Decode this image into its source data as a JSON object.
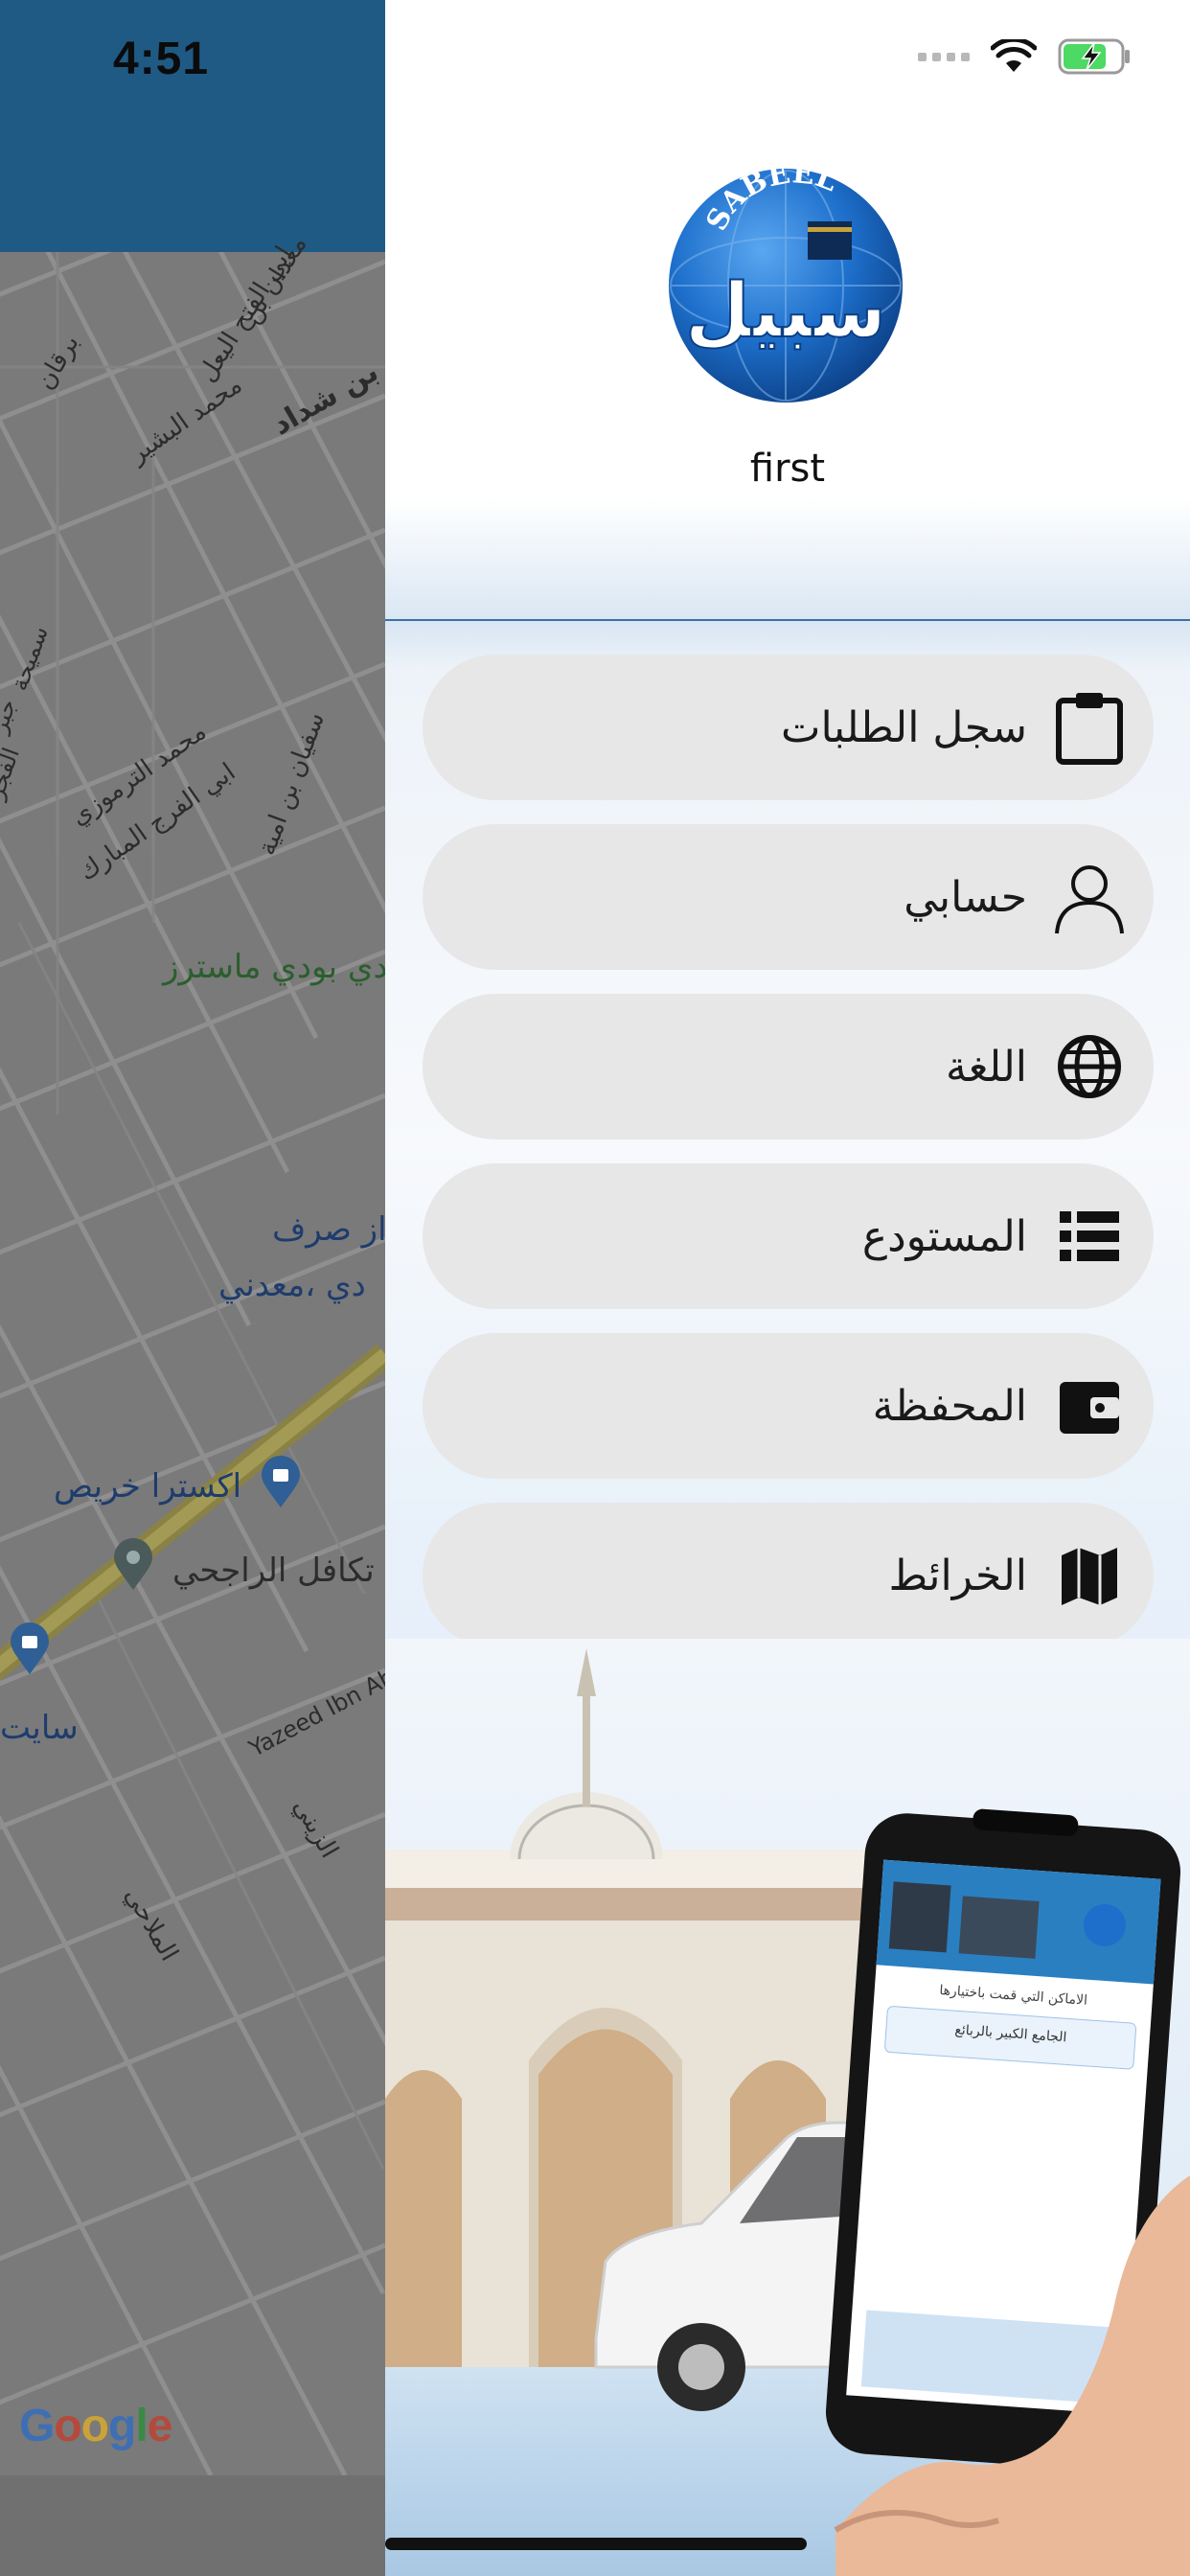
{
  "status_bar": {
    "time": "4:51"
  },
  "drawer": {
    "brand_latin": "SABEEL",
    "brand_arabic": "سبيل",
    "username": "first",
    "menu": [
      {
        "label": "سجل الطلبات",
        "icon": "clipboard-icon"
      },
      {
        "label": "حسابي",
        "icon": "user-icon"
      },
      {
        "label": "اللغة",
        "icon": "globe-icon"
      },
      {
        "label": "المستودع",
        "icon": "warehouse-list-icon"
      },
      {
        "label": "المحفظة",
        "icon": "wallet-icon"
      },
      {
        "label": "الخرائط",
        "icon": "map-icon"
      }
    ]
  },
  "map": {
    "labels": {
      "body_masters": "دي بودي ماسترز",
      "exchange": "از صرف",
      "madani": "دي ،معدني",
      "extra": "اكسترا خريص",
      "takaful": "تكافل الراجحي",
      "site": "سايت",
      "street_1": "معدان بن",
      "street_2": "ابي الفتح اليعل",
      "street_3": "رة بن شداد",
      "street_4": "محمد البشير",
      "street_5": "برقان",
      "street_6": "محمد الترموزي",
      "street_7": "ابي الفرج المبارك",
      "street_8": "سفيان بن امية",
      "street_9": "Yazeed Ibn Ab",
      "street_10": "الزيني",
      "street_11": "الملاحي",
      "street_12": "سميحة",
      "street_13": "الفجر",
      "street_14": "جبر"
    },
    "attribution": "Google"
  },
  "promo": {
    "screen_title": "الاماكن التي قمت باختيارها",
    "screen_item": "الجامع الكبير بالربائع"
  },
  "colors": {
    "map_header": "#1f5a84",
    "menu_pill": "#e7e7e7",
    "divider": "#3d6fa6",
    "brand_blue": "#1763b8"
  }
}
